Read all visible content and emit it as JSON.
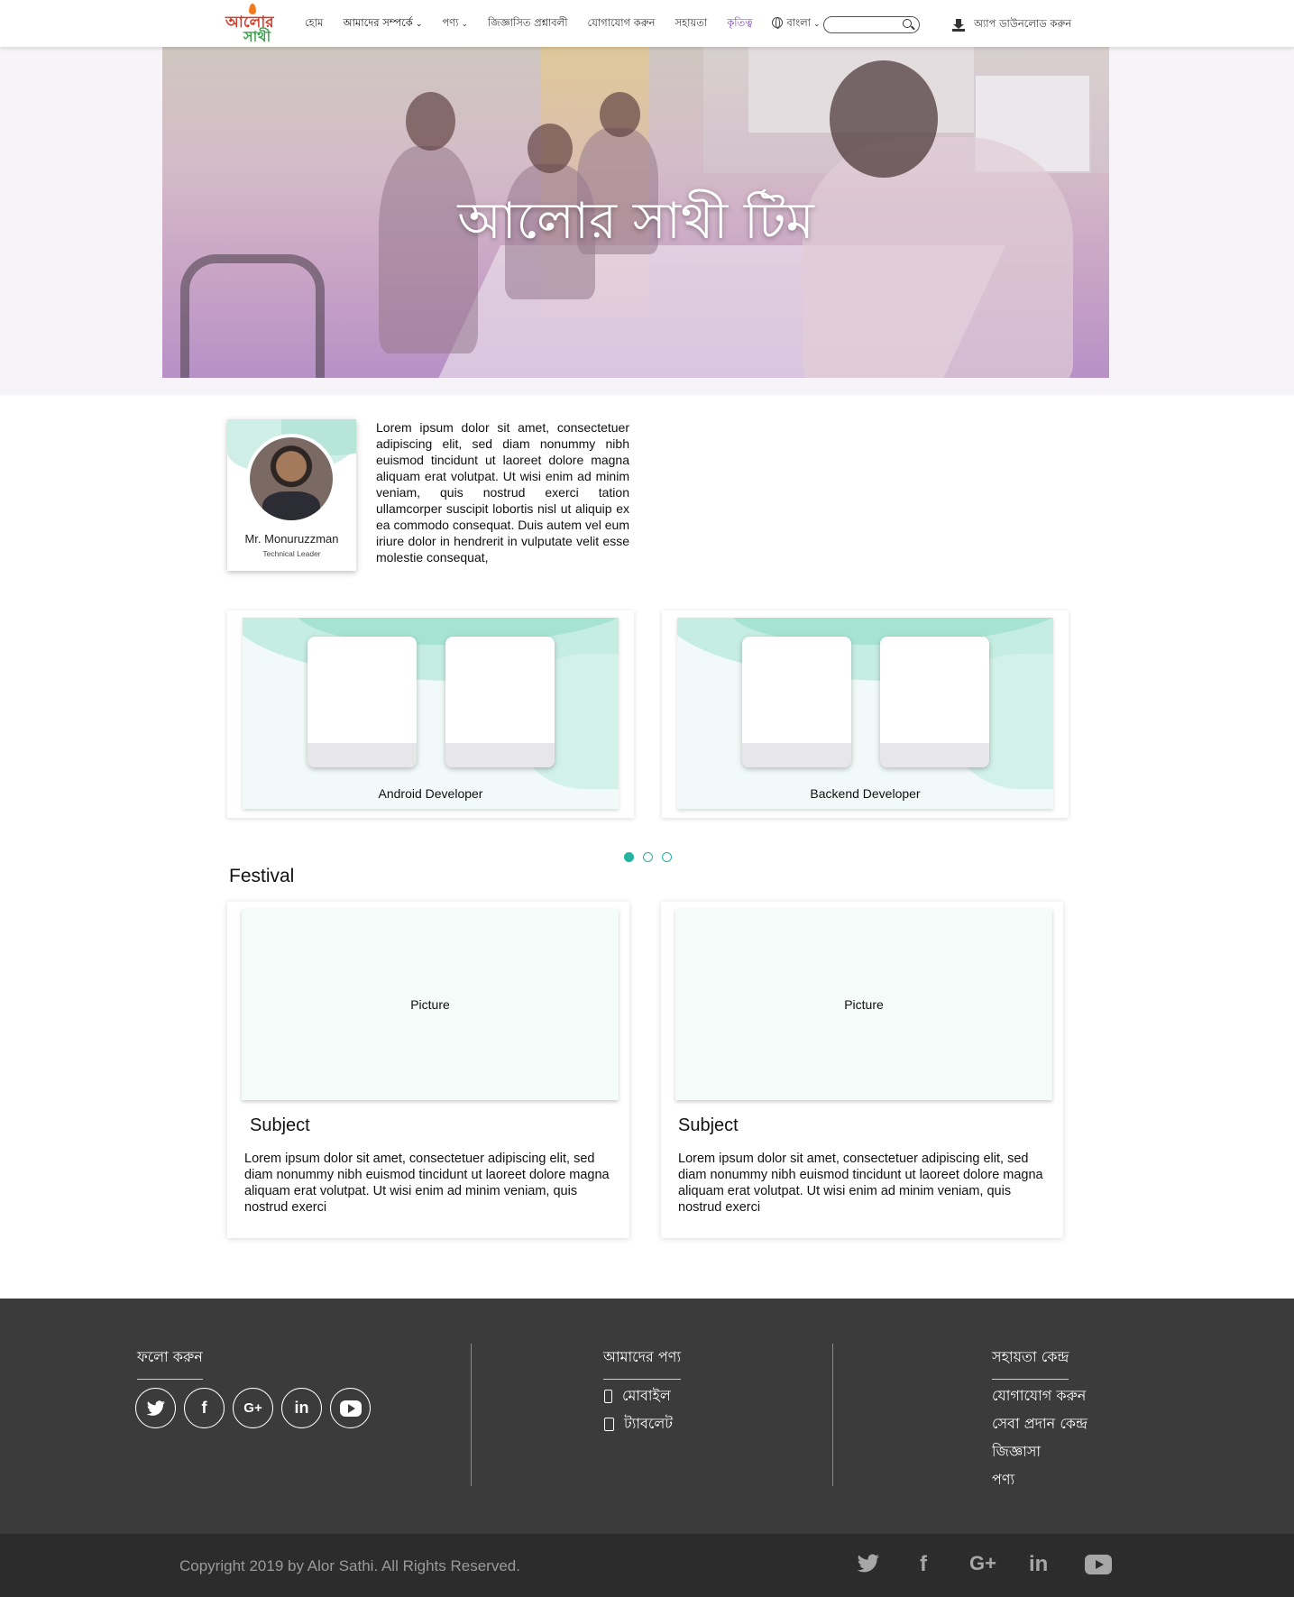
{
  "brand": {
    "logo_line1": "আলোর",
    "logo_line2": "সাথী"
  },
  "nav": {
    "items": [
      {
        "label": "হোম"
      },
      {
        "label": "আমাদের সম্পর্কে"
      },
      {
        "label": "পণ্য"
      },
      {
        "label": "জিজ্ঞাসিত প্রশ্নাবলী"
      },
      {
        "label": "যোগাযোগ করুন"
      },
      {
        "label": "সহায়তা"
      },
      {
        "label": "কৃতিত্ব"
      },
      {
        "label": "বাংলা"
      }
    ],
    "search_placeholder": "",
    "download_label": "অ্যাপ ডাউনলোড করুন",
    "active_color": "#7a3fbf"
  },
  "hero": {
    "title": "আলোর সাথী টিম"
  },
  "leader": {
    "name": "Mr. Monuruzzman",
    "role": "Technical Leader",
    "bio": "Lorem ipsum dolor sit amet, consectetuer adipiscing elit, sed diam nonummy nibh euismod tincidunt ut laoreet dolore magna aliquam erat volutpat. Ut wisi enim ad minim veniam, quis nostrud exerci tation ullamcorper suscipit lobortis nisl ut aliquip ex ea commodo consequat. Duis autem vel eum iriure dolor in hendrerit in vulputate velit esse molestie consequat,"
  },
  "teams": [
    {
      "label": "Android Developer"
    },
    {
      "label": "Backend Developer"
    }
  ],
  "carousel": {
    "pages": 3,
    "active": 1,
    "accent": "#26b3a0"
  },
  "festival": {
    "title": "Festival",
    "cards": [
      {
        "picture": "Picture",
        "subject": "Subject",
        "body": "Lorem ipsum dolor sit amet, consectetuer adipiscing elit, sed diam nonummy nibh euismod tincidunt ut laoreet dolore magna aliquam erat volutpat. Ut wisi enim ad minim veniam, quis nostrud exerci"
      },
      {
        "picture": "Picture",
        "subject": "Subject",
        "body": "Lorem ipsum dolor sit amet, consectetuer adipiscing elit, sed diam nonummy nibh euismod tincidunt ut laoreet dolore magna aliquam erat volutpat. Ut wisi enim ad minim veniam, quis nostrud exerci"
      }
    ]
  },
  "footer": {
    "follow_title": "ফলো করুন",
    "products_title": "আমাদের পণ্য",
    "products": [
      {
        "label": "মোবাইল"
      },
      {
        "label": "ট্যাবলেট"
      }
    ],
    "support_title": "সহায়তা কেন্দ্র",
    "support_links": [
      {
        "label": "যোগাযোগ করুন"
      },
      {
        "label": "সেবা প্রদান কেন্দ্র"
      },
      {
        "label": "জিজ্ঞাসা"
      },
      {
        "label": "পণ্য"
      }
    ],
    "social_icons": [
      "twitter-icon",
      "facebook-icon",
      "google-plus-icon",
      "linkedin-icon",
      "youtube-icon"
    ],
    "social_glyphs": {
      "facebook": "f",
      "google": "G+",
      "linkedin": "in"
    },
    "copyright": "Copyright 2019 by Alor Sathi. All Rights Reserved."
  }
}
